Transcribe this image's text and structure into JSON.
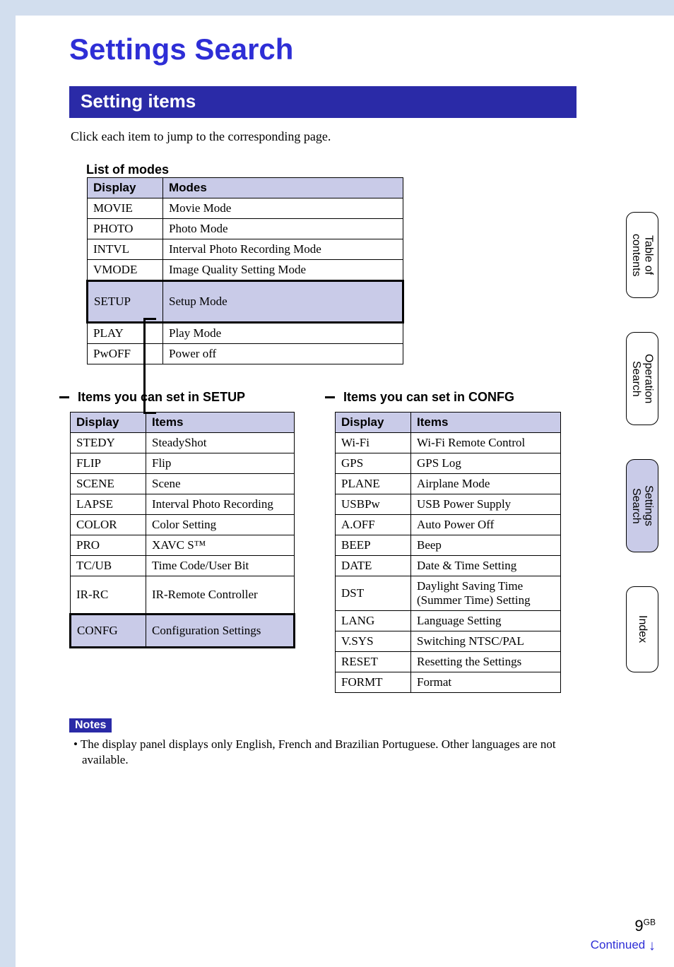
{
  "page_title": "Settings Search",
  "section_title": "Setting items",
  "intro": "Click each item to jump to the corresponding page.",
  "modes": {
    "caption": "List of modes",
    "headers": {
      "col1": "Display",
      "col2": "Modes"
    },
    "rows": [
      {
        "display": "MOVIE",
        "mode": "Movie Mode"
      },
      {
        "display": "PHOTO",
        "mode": "Photo Mode"
      },
      {
        "display": "INTVL",
        "mode": "Interval Photo Recording Mode"
      },
      {
        "display": "VMODE",
        "mode": "Image Quality Setting Mode"
      },
      {
        "display": "SETUP",
        "mode": "Setup Mode"
      },
      {
        "display": "PLAY",
        "mode": "Play Mode"
      },
      {
        "display": "PwOFF",
        "mode": "Power off"
      }
    ]
  },
  "setup": {
    "caption": "Items you can set in SETUP",
    "headers": {
      "col1": "Display",
      "col2": "Items"
    },
    "rows": [
      {
        "display": "STEDY",
        "item": "SteadyShot"
      },
      {
        "display": "FLIP",
        "item": "Flip"
      },
      {
        "display": "SCENE",
        "item": "Scene"
      },
      {
        "display": "LAPSE",
        "item": "Interval Photo Recording"
      },
      {
        "display": "COLOR",
        "item": "Color Setting"
      },
      {
        "display": "PRO",
        "item": "XAVC S™"
      },
      {
        "display": "TC/UB",
        "item": "Time Code/User Bit"
      },
      {
        "display": "IR-RC",
        "item": "IR-Remote Controller"
      },
      {
        "display": "CONFG",
        "item": "Configuration Settings"
      }
    ]
  },
  "confg": {
    "caption": "Items you can set in CONFG",
    "headers": {
      "col1": "Display",
      "col2": "Items"
    },
    "rows": [
      {
        "display": "Wi-Fi",
        "item": "Wi-Fi Remote Control"
      },
      {
        "display": "GPS",
        "item": "GPS Log"
      },
      {
        "display": "PLANE",
        "item": "Airplane Mode"
      },
      {
        "display": "USBPw",
        "item": "USB Power Supply"
      },
      {
        "display": "A.OFF",
        "item": "Auto Power Off"
      },
      {
        "display": "BEEP",
        "item": "Beep"
      },
      {
        "display": "DATE",
        "item": "Date & Time Setting"
      },
      {
        "display": "DST",
        "item": "Daylight Saving Time (Summer Time) Setting"
      },
      {
        "display": "LANG",
        "item": "Language Setting"
      },
      {
        "display": "V.SYS",
        "item": "Switching NTSC/PAL"
      },
      {
        "display": "RESET",
        "item": "Resetting the Settings"
      },
      {
        "display": "FORMT",
        "item": "Format"
      }
    ]
  },
  "notes": {
    "label": "Notes",
    "text": "The display panel displays only English, French and Brazilian Portuguese. Other languages are not available."
  },
  "side_tabs": {
    "toc": "Table of contents",
    "op": "Operation Search",
    "settings": "Settings Search",
    "index": "Index"
  },
  "footer": {
    "page_num": "9",
    "page_suffix": "GB",
    "continued": "Continued",
    "arrow": "↓"
  }
}
